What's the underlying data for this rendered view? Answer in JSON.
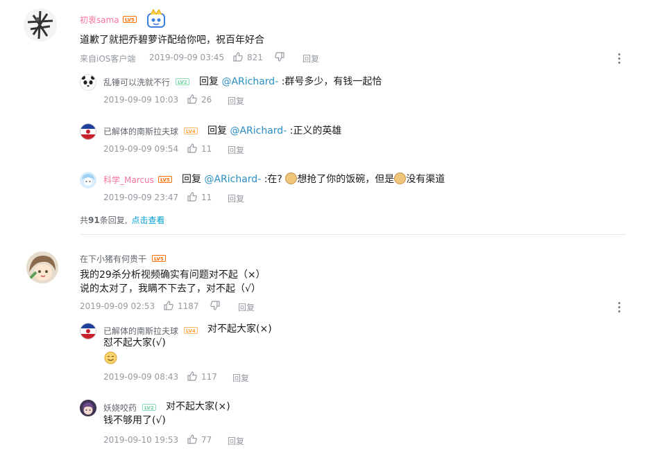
{
  "comments": [
    {
      "user": "初衷sama",
      "level": "LV5",
      "content": "道歉了就把乔碧萝许配给你吧，祝百年好合",
      "source": "来自iOS客户端",
      "time": "2019-09-09 03:45",
      "likes": "821",
      "reply_label": "回复",
      "replies": [
        {
          "user": "乱锤可以洗就不行",
          "level": "LV2",
          "reply_prefix": "回复",
          "at": "@ARichard-",
          "text": ":群号多少，有钱一起恰",
          "time": "2019-09-09 10:03",
          "likes": "26",
          "reply_label": "回复"
        },
        {
          "user": "已解体的南斯拉夫球",
          "level": "LV4",
          "reply_prefix": "回复",
          "at": "@ARichard-",
          "text": ":正义的英雄",
          "time": "2019-09-09 09:54",
          "likes": "11",
          "reply_label": "回复"
        },
        {
          "user": "科学_Marcus",
          "level": "LV5",
          "reply_prefix": "回复",
          "at": "@ARichard-",
          "text_a": ":在?",
          "text_b": "想抢了你的饭碗，但是",
          "text_c": "没有渠道",
          "time": "2019-09-09 23:47",
          "likes": "11",
          "reply_label": "回复"
        }
      ],
      "total_prefix": "共",
      "total_count": "91",
      "total_suffix": "条回复,",
      "view_link": "点击查看"
    },
    {
      "user": "在下小猪有何贵干",
      "level": "LV5",
      "content_line1": "我的29杀分析视频确实有问题对不起（×）",
      "content_line2": "说的太对了，我瞒不下去了，对不起（√）",
      "time": "2019-09-09 02:53",
      "likes": "1187",
      "reply_label": "回复",
      "replies": [
        {
          "user": "已解体的南斯拉夫球",
          "level": "LV4",
          "line1": "对不起大家(×)",
          "line2": "怼不起大家(√)",
          "time": "2019-09-09 08:43",
          "likes": "117",
          "reply_label": "回复"
        },
        {
          "user": "妖娆咬药",
          "level": "LV2",
          "line1": "对不起大家(×)",
          "line2": "钱不够用了(√)",
          "time": "2019-09-10 19:53",
          "likes": "77",
          "reply_label": "回复"
        }
      ]
    }
  ]
}
